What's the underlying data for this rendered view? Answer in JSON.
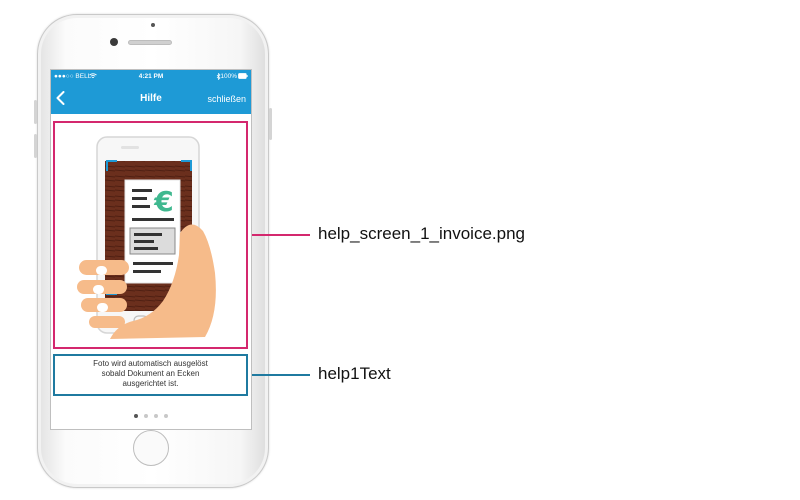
{
  "status_bar": {
    "carrier": "●●●○○ BELL",
    "time": "4:21 PM",
    "battery": "100%"
  },
  "nav_bar": {
    "back_icon": "chevron-left-icon",
    "title": "Hilfe",
    "close_label": "schließen"
  },
  "help_text": {
    "lines": [
      "Foto wird automatisch ausgelöst",
      "sobald Dokument an Ecken",
      "ausgerichtet ist."
    ]
  },
  "pager": {
    "count": 4,
    "active": 1
  },
  "annotations": {
    "image_label": "help_screen_1_invoice.png",
    "text_label": "help1Text"
  },
  "colors": {
    "nav_blue": "#1e9ad6",
    "image_outline": "#d4286e",
    "text_outline": "#1f7aa0",
    "euro_green": "#3fb88f",
    "hand_skin": "#f6bb8a",
    "corner_blue": "#1e9ad6"
  }
}
